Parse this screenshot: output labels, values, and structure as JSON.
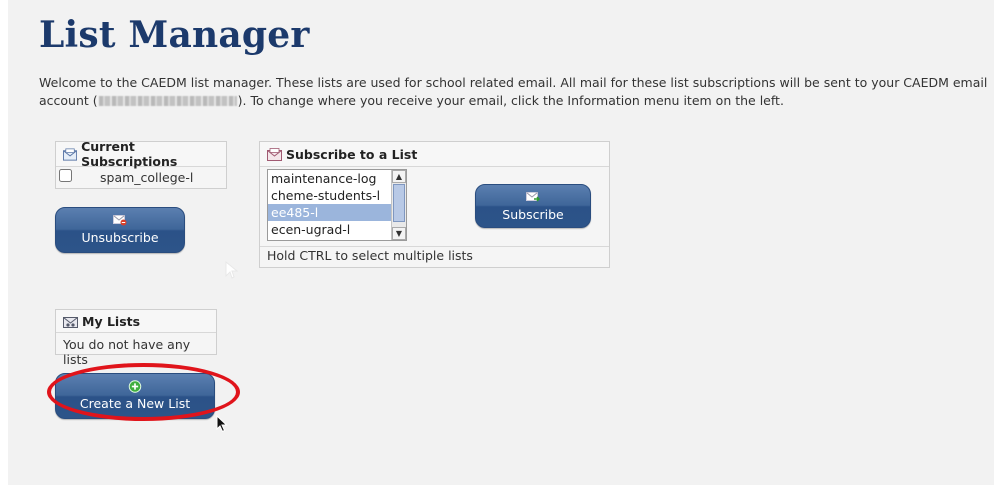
{
  "page": {
    "title": "List Manager",
    "intro_before": "Welcome to the CAEDM list manager. These lists are used for school related email. All mail for these list subscriptions will be sent to your CAEDM email account (",
    "intro_after": "). To change where you receive your email, click the Information menu item on the left."
  },
  "current_subscriptions": {
    "header": "Current Subscriptions",
    "items": [
      {
        "label": "spam_college-l",
        "checked": false
      }
    ],
    "unsubscribe_label": "Unsubscribe"
  },
  "subscribe": {
    "header": "Subscribe to a List",
    "options": [
      {
        "label": "maintenance-log",
        "selected": false
      },
      {
        "label": "cheme-students-l",
        "selected": false
      },
      {
        "label": "ee485-l",
        "selected": true
      },
      {
        "label": "ecen-ugrad-l",
        "selected": false
      }
    ],
    "button_label": "Subscribe",
    "hint": "Hold CTRL to select multiple lists"
  },
  "my_lists": {
    "header": "My Lists",
    "empty_text": "You do not have any lists",
    "create_label": "Create a New List"
  },
  "colors": {
    "title": "#1c3a6c",
    "button": "#3f6699",
    "highlight_ring": "#e0141b",
    "selected_option": "#9bb5dc"
  },
  "icons": [
    "envelope-icon",
    "envelope-remove-icon",
    "envelope-add-icon",
    "plus-circle-icon",
    "mouse-pointer-icon"
  ]
}
